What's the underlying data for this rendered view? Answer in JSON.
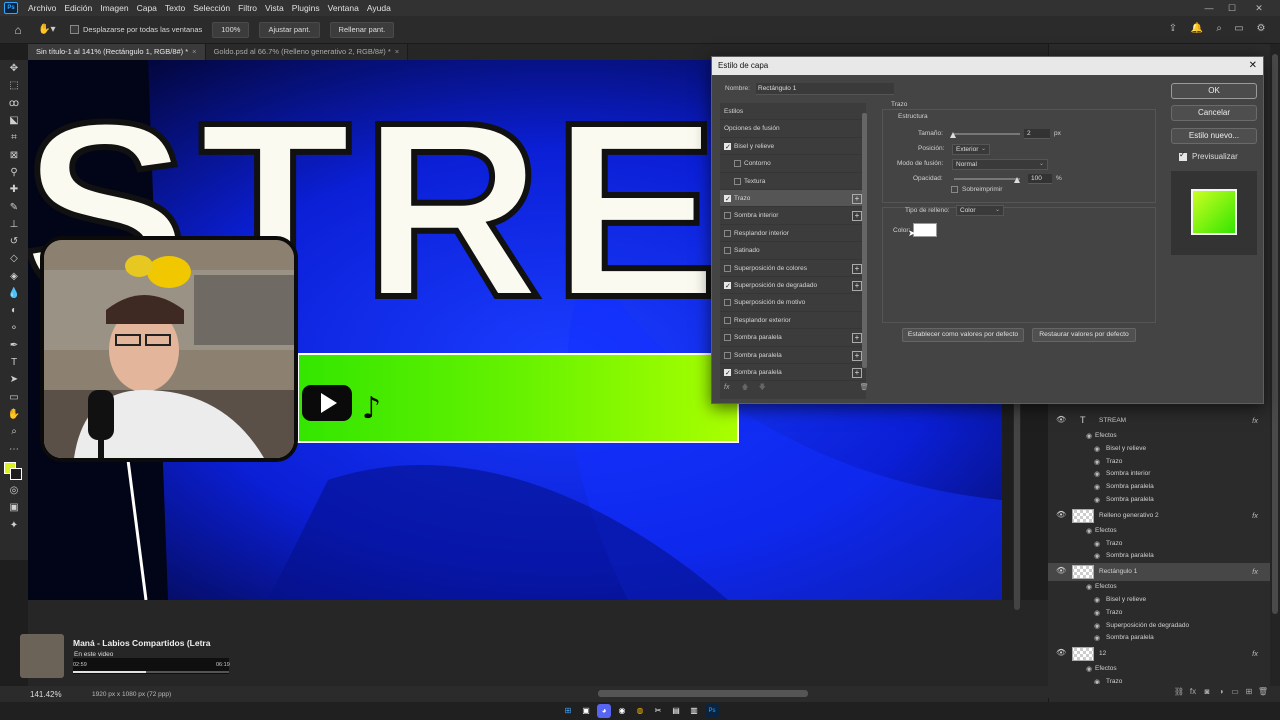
{
  "menubar": {
    "logo": "Ps",
    "items": [
      "Archivo",
      "Edición",
      "Imagen",
      "Capa",
      "Texto",
      "Selección",
      "Filtro",
      "Vista",
      "Plugins",
      "Ventana",
      "Ayuda"
    ]
  },
  "optionsbar": {
    "scroll_all_label": "Desplazarse por todas las ventanas",
    "zoom_btn": "100%",
    "fit_btn": "Ajustar pant.",
    "fill_btn": "Rellenar pant."
  },
  "tabs": [
    {
      "label": "Sin título-1 al 141% (Rectángulo 1, RGB/8#) *",
      "active": true
    },
    {
      "label": "Goldo.psd al 66.7% (Relleno generativo 2, RGB/8#) *",
      "active": false
    }
  ],
  "canvas": {
    "headline": "STREA"
  },
  "media": {
    "title": "Maná - Labios Compartidos (Letra",
    "subtitle": "En este video",
    "current": "02:59",
    "total": "06:19",
    "progress": 0.47
  },
  "statusbar": {
    "zoom": "141.42%",
    "info": "1920 px x 1080 px (72 ppp)"
  },
  "dialog": {
    "title": "Estilo de capa",
    "name_label": "Nombre:",
    "name_value": "Rectángulo 1",
    "styles": [
      {
        "label": "Estilos",
        "checkbox": false,
        "checked": false,
        "plus": false,
        "indent": false,
        "selected": false
      },
      {
        "label": "Opciones de fusión",
        "checkbox": false,
        "checked": false,
        "plus": false,
        "indent": false,
        "selected": false
      },
      {
        "label": "Bisel y relieve",
        "checkbox": true,
        "checked": true,
        "plus": false,
        "indent": false,
        "selected": false
      },
      {
        "label": "Contorno",
        "checkbox": true,
        "checked": false,
        "plus": false,
        "indent": true,
        "selected": false
      },
      {
        "label": "Textura",
        "checkbox": true,
        "checked": false,
        "plus": false,
        "indent": true,
        "selected": false
      },
      {
        "label": "Trazo",
        "checkbox": true,
        "checked": true,
        "plus": true,
        "indent": false,
        "selected": true
      },
      {
        "label": "Sombra interior",
        "checkbox": true,
        "checked": false,
        "plus": true,
        "indent": false,
        "selected": false
      },
      {
        "label": "Resplandor interior",
        "checkbox": true,
        "checked": false,
        "plus": false,
        "indent": false,
        "selected": false
      },
      {
        "label": "Satinado",
        "checkbox": true,
        "checked": false,
        "plus": false,
        "indent": false,
        "selected": false
      },
      {
        "label": "Superposición de colores",
        "checkbox": true,
        "checked": false,
        "plus": true,
        "indent": false,
        "selected": false
      },
      {
        "label": "Superposición de degradado",
        "checkbox": true,
        "checked": true,
        "plus": true,
        "indent": false,
        "selected": false
      },
      {
        "label": "Superposición de motivo",
        "checkbox": true,
        "checked": false,
        "plus": false,
        "indent": false,
        "selected": false
      },
      {
        "label": "Resplandor exterior",
        "checkbox": true,
        "checked": false,
        "plus": false,
        "indent": false,
        "selected": false
      },
      {
        "label": "Sombra paralela",
        "checkbox": true,
        "checked": false,
        "plus": true,
        "indent": false,
        "selected": false
      },
      {
        "label": "Sombra paralela",
        "checkbox": true,
        "checked": false,
        "plus": true,
        "indent": false,
        "selected": false
      },
      {
        "label": "Sombra paralela",
        "checkbox": true,
        "checked": true,
        "plus": true,
        "indent": false,
        "selected": false
      }
    ],
    "footer_fx": "fx",
    "stroke": {
      "section": "Trazo",
      "structure": "Estructura",
      "size_label": "Tamaño:",
      "size_value": "2",
      "size_unit": "px",
      "position_label": "Posición:",
      "position_value": "Exterior",
      "blend_label": "Modo de fusión:",
      "blend_value": "Normal",
      "opacity_label": "Opacidad:",
      "opacity_value": "100",
      "opacity_unit": "%",
      "overprint_label": "Sobreimprimir",
      "fill_type_label": "Tipo de relleno:",
      "fill_type_value": "Color",
      "color_label": "Color:",
      "color_value": "#ffffff",
      "set_default": "Establecer como valores por defecto",
      "reset_default": "Restaurar valores por defecto"
    },
    "buttons": {
      "ok": "OK",
      "cancel": "Cancelar",
      "new_style": "Estilo nuevo...",
      "preview": "Previsualizar"
    }
  },
  "layers": [
    {
      "type": "layer",
      "name": "STREAM",
      "kind": "text",
      "fx": true,
      "selected": false
    },
    {
      "type": "effects",
      "name": "Efectos"
    },
    {
      "type": "effect",
      "name": "Bisel y relieve"
    },
    {
      "type": "effect",
      "name": "Trazo"
    },
    {
      "type": "effect",
      "name": "Sombra interior"
    },
    {
      "type": "effect",
      "name": "Sombra paralela"
    },
    {
      "type": "effect",
      "name": "Sombra paralela"
    },
    {
      "type": "layer",
      "name": "Relleno generativo 2",
      "kind": "image",
      "fx": true,
      "selected": false
    },
    {
      "type": "effects",
      "name": "Efectos"
    },
    {
      "type": "effect",
      "name": "Trazo"
    },
    {
      "type": "effect",
      "name": "Sombra paralela"
    },
    {
      "type": "layer",
      "name": "Rectángulo 1",
      "kind": "shape",
      "fx": true,
      "selected": true
    },
    {
      "type": "effects",
      "name": "Efectos"
    },
    {
      "type": "effect",
      "name": "Bisel y relieve"
    },
    {
      "type": "effect",
      "name": "Trazo"
    },
    {
      "type": "effect",
      "name": "Superposición de degradado"
    },
    {
      "type": "effect",
      "name": "Sombra paralela"
    },
    {
      "type": "layer",
      "name": "12",
      "kind": "image",
      "fx": true,
      "selected": false
    },
    {
      "type": "effects",
      "name": "Efectos"
    },
    {
      "type": "effect",
      "name": "Trazo"
    }
  ],
  "colors": {
    "accent_green": "#ccff22",
    "canvas_blue": "#0b1fd6",
    "foreground_swatch": "#d9f21f"
  }
}
